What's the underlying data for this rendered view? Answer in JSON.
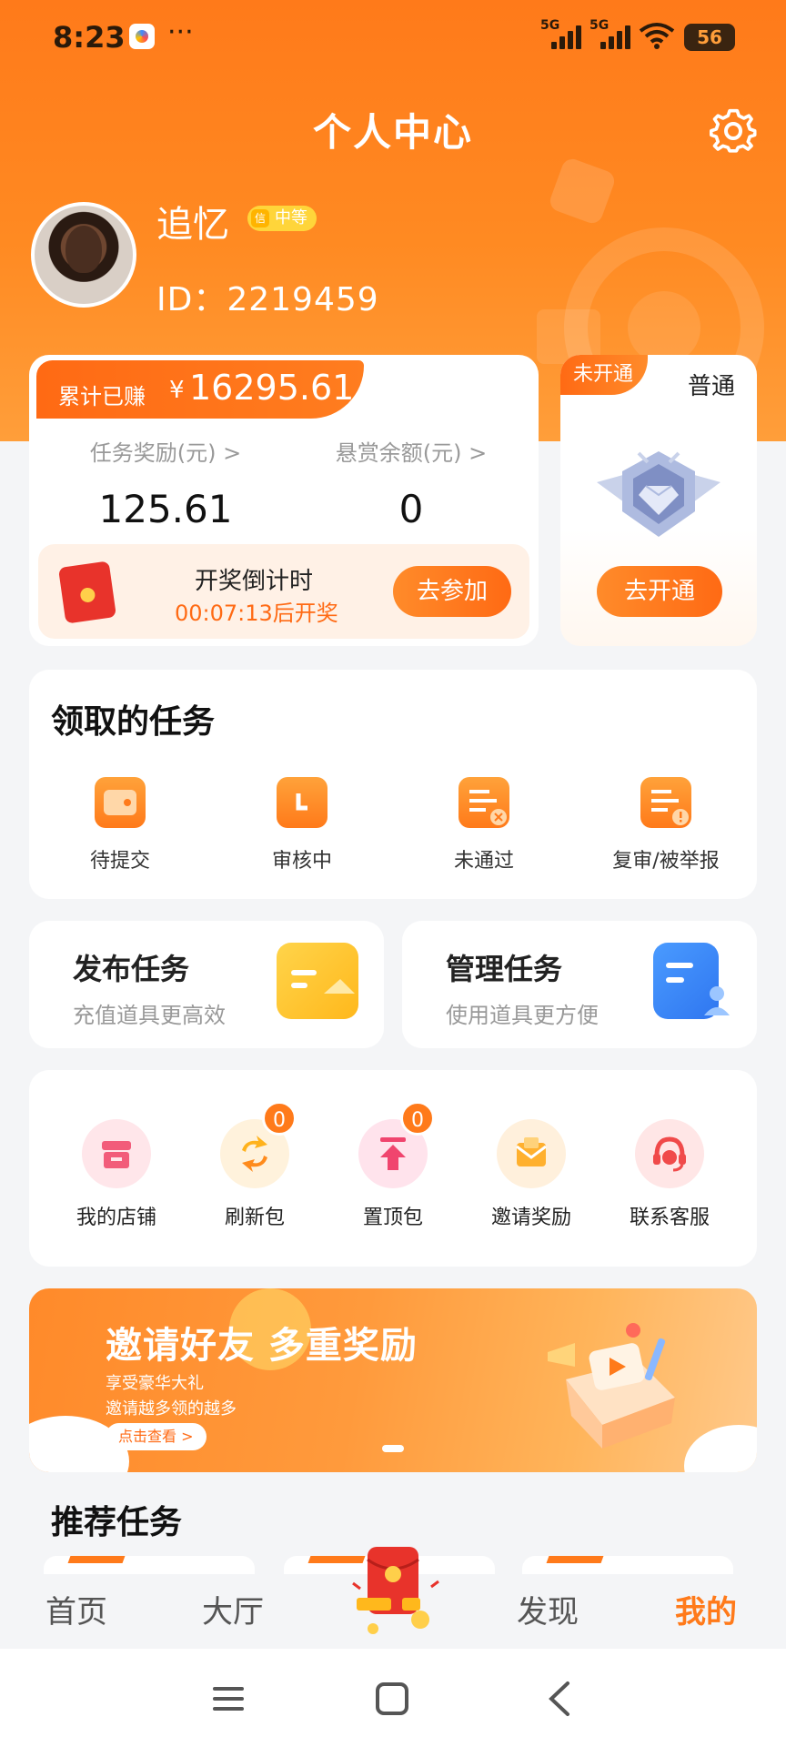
{
  "status_bar": {
    "time": "8:23",
    "more": "···",
    "sig1": "5G",
    "sig2": "5G",
    "battery": "56"
  },
  "header": {
    "title": "个人中心",
    "settings_icon": "gear-icon"
  },
  "profile": {
    "name": "追忆",
    "level_badge_icon": "信",
    "level_badge": "中等",
    "id_text": "ID：2219459"
  },
  "earnings": {
    "label": "累计已赚",
    "currency": "¥",
    "total": "16295.61",
    "task_reward_label": "任务奖励(元) >",
    "task_reward_value": "125.61",
    "bounty_label": "悬赏余额(元) >",
    "bounty_value": "0"
  },
  "lottery": {
    "title": "开奖倒计时",
    "countdown": "00:07:13后开奖",
    "button": "去参加"
  },
  "vip": {
    "tag": "未开通",
    "level": "普通",
    "button": "去开通"
  },
  "received_tasks": {
    "title": "领取的任务",
    "items": [
      {
        "label": "待提交",
        "icon": "wallet-icon"
      },
      {
        "label": "审核中",
        "icon": "clock-icon"
      },
      {
        "label": "未通过",
        "icon": "rejected-doc-icon"
      },
      {
        "label": "复审/被举报",
        "icon": "warning-doc-icon"
      }
    ]
  },
  "publish": {
    "title": "发布任务",
    "subtitle": "充值道具更高效"
  },
  "manage": {
    "title": "管理任务",
    "subtitle": "使用道具更方便"
  },
  "tools": [
    {
      "label": "我的店铺",
      "icon": "shop-icon"
    },
    {
      "label": "刷新包",
      "icon": "refresh-icon",
      "badge": "0"
    },
    {
      "label": "置顶包",
      "icon": "pin-top-icon",
      "badge": "0"
    },
    {
      "label": "邀请奖励",
      "icon": "invite-mail-icon"
    },
    {
      "label": "联系客服",
      "icon": "customer-service-icon"
    }
  ],
  "banner": {
    "title": "邀请好友 多重奖励",
    "line1": "享受豪华大礼",
    "line2": "邀请越多领的越多",
    "button": "点击查看 >"
  },
  "recommend": {
    "title": "推荐任务"
  },
  "tabbar": {
    "home": "首页",
    "hall": "大厅",
    "discover": "发现",
    "mine": "我的"
  },
  "colors": {
    "primary": "#ff7a1a",
    "accent_dark": "#ff6a14",
    "background": "#f4f5f7"
  }
}
